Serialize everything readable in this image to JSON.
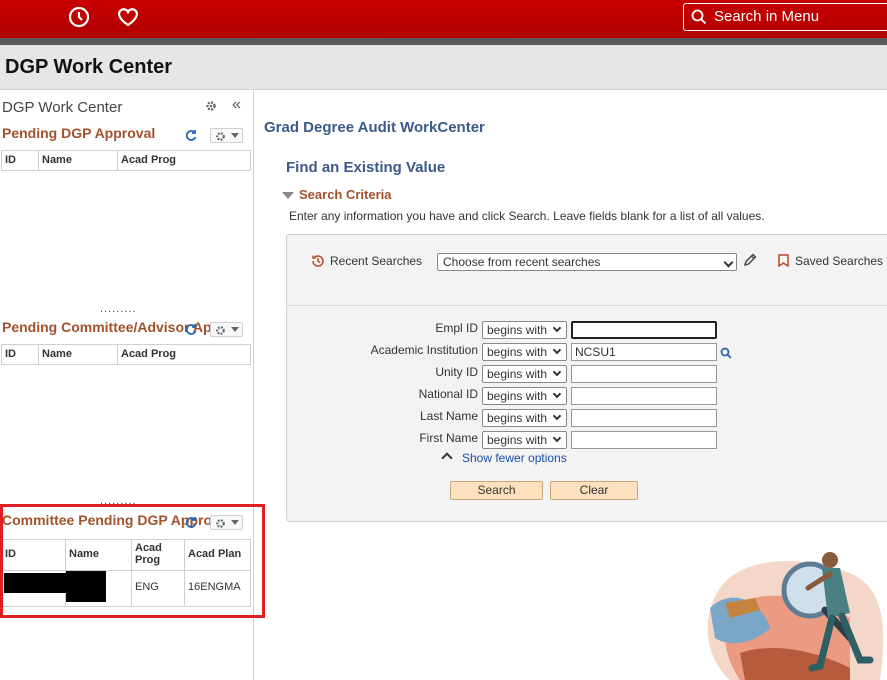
{
  "header": {
    "search_placeholder": "Search in Menu"
  },
  "page": {
    "title": "DGP Work Center"
  },
  "sidebar": {
    "title": "DGP Work Center",
    "sections": [
      {
        "title": "Pending DGP Approval",
        "columns": [
          "ID",
          "Name",
          "Acad Prog"
        ]
      },
      {
        "title": "Pending Committee/Advisor Appr",
        "columns": [
          "ID",
          "Name",
          "Acad Prog"
        ]
      },
      {
        "title": "Committee Pending DGP Approval",
        "columns": [
          "ID",
          "Name",
          "Acad Prog",
          "Acad Plan"
        ],
        "rows": [
          {
            "id": "",
            "name": "",
            "acad_prog": "ENG",
            "acad_plan": "16ENGMA"
          }
        ]
      }
    ],
    "dots": "........."
  },
  "main": {
    "title": "Grad Degree Audit WorkCenter",
    "find_heading": "Find an Existing Value",
    "criteria_label": "Search Criteria",
    "help_text": "Enter any information you have and click Search. Leave fields blank for a list of all values.",
    "recent_label": "Recent Searches",
    "recent_select": "Choose from recent searches",
    "saved_label": "Saved Searches",
    "fields": [
      {
        "label": "Empl ID",
        "op": "begins with",
        "value": ""
      },
      {
        "label": "Academic Institution",
        "op": "begins with",
        "value": "NCSU1"
      },
      {
        "label": "Unity ID",
        "op": "begins with",
        "value": ""
      },
      {
        "label": "National ID",
        "op": "begins with",
        "value": ""
      },
      {
        "label": "Last Name",
        "op": "begins with",
        "value": ""
      },
      {
        "label": "First Name",
        "op": "begins with",
        "value": ""
      }
    ],
    "fewer_options": "Show fewer options",
    "search_button": "Search",
    "clear_button": "Clear"
  },
  "colors": {
    "brand_red": "#c80000",
    "section_title": "#a0522d",
    "heading_blue": "#3b5a8a",
    "highlight_box": "#e02020"
  }
}
